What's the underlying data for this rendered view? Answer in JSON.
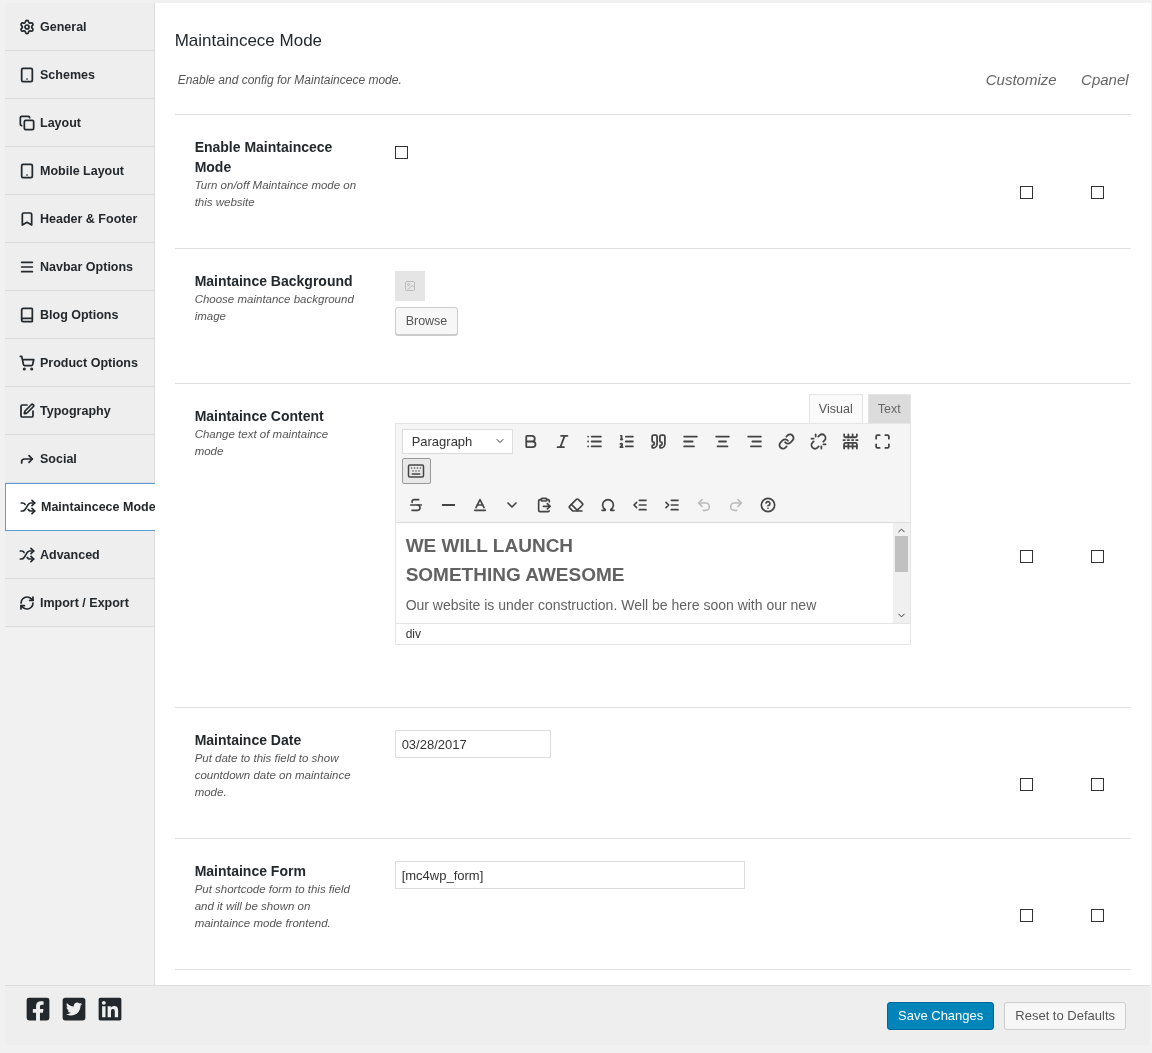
{
  "sidebar": {
    "items": [
      {
        "label": "General",
        "selected": false
      },
      {
        "label": "Schemes",
        "selected": false
      },
      {
        "label": "Layout",
        "selected": false
      },
      {
        "label": "Mobile Layout",
        "selected": false
      },
      {
        "label": "Header & Footer",
        "selected": false
      },
      {
        "label": "Navbar Options",
        "selected": false
      },
      {
        "label": "Blog Options",
        "selected": false
      },
      {
        "label": "Product Options",
        "selected": false
      },
      {
        "label": "Typography",
        "selected": false
      },
      {
        "label": "Social",
        "selected": false
      },
      {
        "label": "Maintaincece Mode",
        "selected": true
      },
      {
        "label": "Advanced",
        "selected": false
      },
      {
        "label": "Import / Export",
        "selected": false
      }
    ]
  },
  "section": {
    "title": "Maintaincece Mode",
    "description": "Enable and config for Maintaincece mode.",
    "column_headers": [
      "Customize",
      "Cpanel"
    ]
  },
  "settings": [
    {
      "kind": "checkbox",
      "title": "Enable Maintaincece Mode",
      "description": "Turn on/off Maintaince mode on this website",
      "checked": false,
      "customize_checked": false,
      "cpanel_checked": false
    },
    {
      "kind": "media",
      "title": "Maintaince Background",
      "description": "Choose maintance background image",
      "button": "Browse"
    },
    {
      "kind": "editor",
      "title": "Maintaince Content",
      "description": "Change text of maintaince mode",
      "customize_checked": false,
      "cpanel_checked": false,
      "editor": {
        "tabs": [
          {
            "label": "Visual",
            "selected": true
          },
          {
            "label": "Text",
            "selected": false
          }
        ],
        "format": "Paragraph",
        "toolbar_toggle_pressed": true,
        "heading_lines": [
          "WE WILL LAUNCH",
          "SOMETHING AWESOME"
        ],
        "paragraph": "Our website is under construction. Well be here soon with our new",
        "path": "div"
      }
    },
    {
      "kind": "text",
      "title": "Maintaince Date",
      "description": "Put date to this field to show countdown date on maintaince mode.",
      "value": "03/28/2017",
      "wide": false,
      "customize_checked": false,
      "cpanel_checked": false
    },
    {
      "kind": "text",
      "title": "Maintaince Form",
      "description": "Put shortcode form to this field and it will be shown on maintaince mode frontend.",
      "value": "[mc4wp_form]",
      "wide": true,
      "customize_checked": false,
      "cpanel_checked": false
    }
  ],
  "footer": {
    "buttons": [
      {
        "label": "Save Changes",
        "kind": "primary"
      },
      {
        "label": "Reset to Defaults",
        "kind": "secondary"
      }
    ]
  }
}
